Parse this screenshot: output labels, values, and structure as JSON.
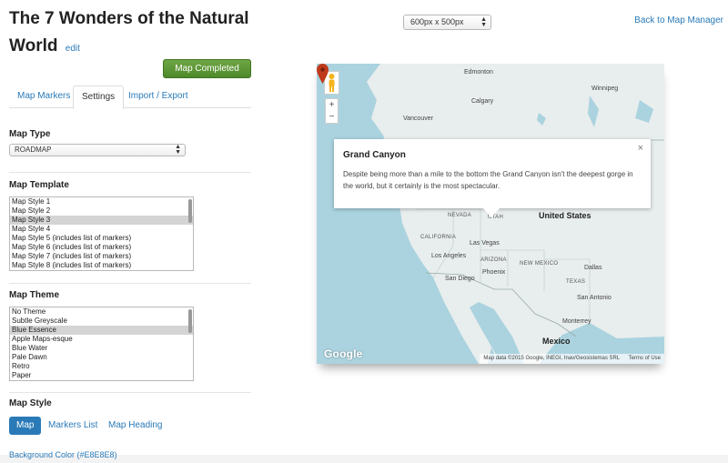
{
  "page": {
    "title": "The 7 Wonders of the Natural World",
    "edit_label": "edit",
    "completed_button": "Map Completed"
  },
  "tabs": [
    {
      "label": "Map Markers",
      "active": false
    },
    {
      "label": "Settings",
      "active": true
    },
    {
      "label": "Import / Export",
      "active": false
    }
  ],
  "map_type": {
    "label": "Map Type",
    "value": "ROADMAP"
  },
  "map_template": {
    "label": "Map Template",
    "options": [
      "Map Style 1",
      "Map Style 2",
      "Map Style 3",
      "Map Style 4",
      "Map Style 5 (includes list of markers)",
      "Map Style 6 (includes list of markers)",
      "Map Style 7 (includes list of markers)",
      "Map Style 8 (includes list of markers)"
    ],
    "selected": "Map Style 3"
  },
  "map_theme": {
    "label": "Map Theme",
    "options": [
      "No Theme",
      "Subtle Greyscale",
      "Blue Essence",
      "Apple Maps-esque",
      "Blue Water",
      "Pale Dawn",
      "Retro",
      "Paper"
    ],
    "selected": "Blue Essence"
  },
  "map_style": {
    "label": "Map Style",
    "tabs": [
      {
        "label": "Map",
        "active": true
      },
      {
        "label": "Markers List",
        "active": false
      },
      {
        "label": "Map Heading",
        "active": false
      }
    ],
    "background_color_label": "Background Color (#E8E8E8)"
  },
  "size_select": {
    "value": "600px x 500px"
  },
  "back_link": "Back to Map Manager",
  "map": {
    "popup_title": "Grand Canyon",
    "popup_text": "Despite being more than a mile to the bottom the Grand Canyon isn't the deepest gorge in the world, but it certainly is the most spectacular.",
    "close_symbol": "×",
    "zoom_in": "+",
    "zoom_out": "−",
    "logo": "Google",
    "attribution": "Map data ©2015 Google, INEGI, Inav/Geosistemas SRL",
    "terms": "Terms of Use",
    "labels": {
      "edmonton": "Edmonton",
      "calgary": "Calgary",
      "vancouver": "Vancouver",
      "winnipeg": "Winnipeg",
      "nevada": "NEVADA",
      "utah": "UTAH",
      "united_states": "United States",
      "california": "CALIFORNIA",
      "las_vegas": "Las Vegas",
      "los_angeles": "Los Angeles",
      "arizona": "ARIZONA",
      "san_diego": "San Diego",
      "phoenix": "Phoenix",
      "new_mexico": "NEW MEXICO",
      "dallas": "Dallas",
      "texas": "TEXAS",
      "san_antonio": "San Antonio",
      "monterrey": "Monterrey",
      "mexico": "Mexico"
    }
  },
  "colors": {
    "link": "#2a7ab8",
    "completed_button": "#5a952f",
    "water": "#aad3df",
    "land": "#e8eded",
    "marker": "#c0391b"
  }
}
